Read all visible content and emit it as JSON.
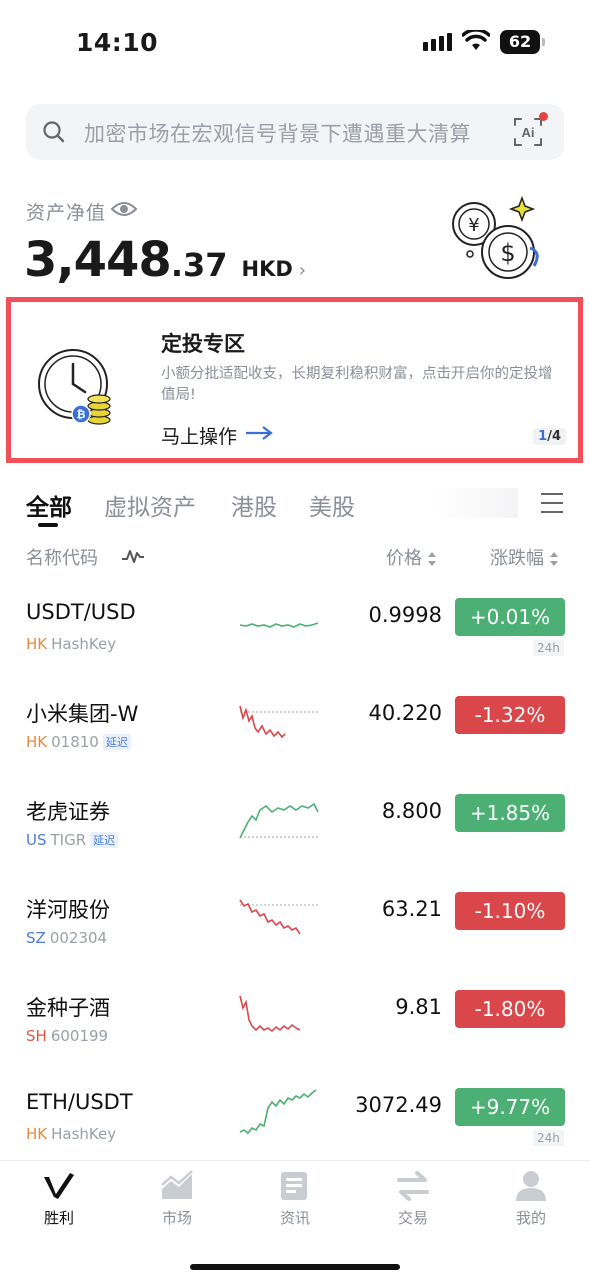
{
  "status_bar": {
    "time": "14:10",
    "battery": "62"
  },
  "search": {
    "placeholder": "加密市场在宏观信号背景下遭遇重大清算",
    "ai_label": "Ai"
  },
  "assets": {
    "label": "资产净值",
    "value_int": "3,448",
    "value_dec": ".37",
    "currency": "HKD",
    "chevron": "›"
  },
  "promo": {
    "title": "定投专区",
    "description": "小额分批适配收支，长期复利稳积财富，点击开启你的定投增值局!",
    "action": "马上操作",
    "page_current": "1",
    "page_total": "/4"
  },
  "tabs": [
    {
      "label": "全部",
      "active": true
    },
    {
      "label": "虚拟资产",
      "active": false
    },
    {
      "label": "港股",
      "active": false
    },
    {
      "label": "美股",
      "active": false
    }
  ],
  "list_header": {
    "name": "名称代码",
    "price": "价格",
    "change": "涨跌幅"
  },
  "rows": [
    {
      "symbol": "USDT/USD",
      "market": "HK",
      "code": "HashKey",
      "delay": "",
      "price": "0.9998",
      "change": "+0.01%",
      "dir": "up",
      "badge": "24h"
    },
    {
      "symbol": "小米集团-W",
      "market": "HK",
      "code": "01810",
      "delay": "延迟",
      "price": "40.220",
      "change": "-1.32%",
      "dir": "down",
      "badge": ""
    },
    {
      "symbol": "老虎证券",
      "market": "US",
      "code": "TIGR",
      "delay": "延迟",
      "price": "8.800",
      "change": "+1.85%",
      "dir": "up",
      "badge": ""
    },
    {
      "symbol": "洋河股份",
      "market": "SZ",
      "code": "002304",
      "delay": "",
      "price": "63.21",
      "change": "-1.10%",
      "dir": "down",
      "badge": ""
    },
    {
      "symbol": "金种子酒",
      "market": "SH",
      "code": "600199",
      "delay": "",
      "price": "9.81",
      "change": "-1.80%",
      "dir": "down",
      "badge": ""
    },
    {
      "symbol": "ETH/USDT",
      "market": "HK",
      "code": "HashKey",
      "delay": "",
      "price": "3072.49",
      "change": "+9.77%",
      "dir": "up",
      "badge": "24h"
    }
  ],
  "bottom_nav": [
    {
      "label": "胜利",
      "icon": "victory-logo-icon",
      "active": true
    },
    {
      "label": "市场",
      "icon": "market-chart-icon",
      "active": false
    },
    {
      "label": "资讯",
      "icon": "news-icon",
      "active": false
    },
    {
      "label": "交易",
      "icon": "trade-arrows-icon",
      "active": false
    },
    {
      "label": "我的",
      "icon": "profile-icon",
      "active": false
    }
  ],
  "colors": {
    "up": "#4caf74",
    "down": "#d9474b",
    "promo_border": "#f0505a",
    "accent_blue": "#3a6fd8"
  }
}
